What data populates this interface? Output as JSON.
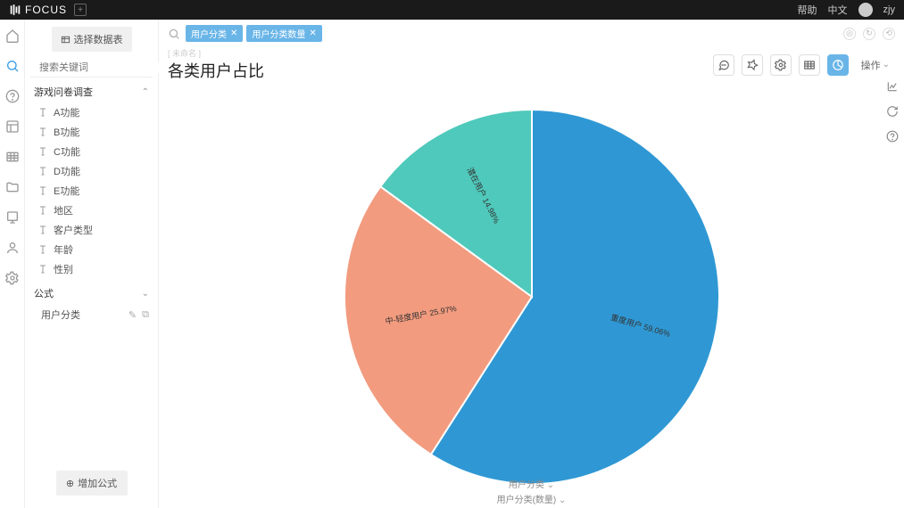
{
  "top": {
    "brand": "FOCUS",
    "help": "帮助",
    "lang": "中文",
    "user": "zjy"
  },
  "side": {
    "select_table_btn": "选择数据表",
    "search_placeholder": "搜索关键词",
    "group1_title": "游戏问卷调查",
    "fields": [
      "A功能",
      "B功能",
      "C功能",
      "D功能",
      "E功能",
      "地区",
      "客户类型",
      "年龄",
      "性别"
    ],
    "formula_header": "公式",
    "formula_items": [
      "用户分类"
    ],
    "add_formula_btn": "增加公式"
  },
  "query": {
    "tags": [
      "用户分类",
      "用户分类数量"
    ]
  },
  "header": {
    "breadcrumb": "[ 未命名 ]",
    "title": "各类用户占比",
    "operate": "操作"
  },
  "footer": {
    "line1": "用户分类",
    "line2": "用户分类(数量)"
  },
  "chart_data": {
    "type": "pie",
    "title": "各类用户占比",
    "series": [
      {
        "name": "重度用户",
        "value": 59.06,
        "label": "重度用户 59.06%",
        "color": "#2f98d4"
      },
      {
        "name": "中-轻度用户",
        "value": 25.97,
        "label": "中-轻度用户 25.97%",
        "color": "#f29b7f"
      },
      {
        "name": "潜在用户",
        "value": 14.98,
        "label": "潜在用户 14.98%",
        "color": "#4fc9bb"
      }
    ]
  }
}
